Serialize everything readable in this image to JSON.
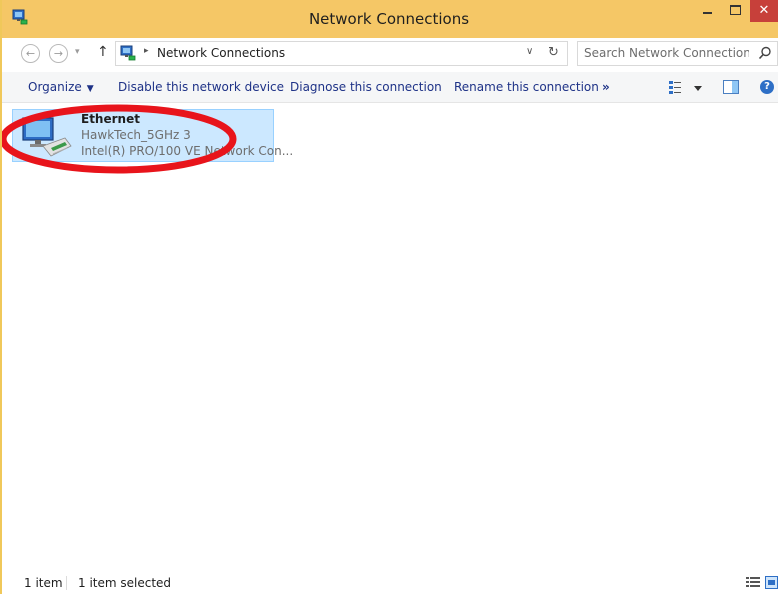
{
  "window": {
    "title": "Network Connections",
    "close_glyph": "✕",
    "title_bar_color": "#f5c766",
    "close_color": "#c7403a"
  },
  "address": {
    "back_glyph": "←",
    "forward_glyph": "→",
    "recent_glyph": "▾",
    "up_glyph": "↑",
    "separator_glyph": "▸",
    "path_text": "Network Connections",
    "dropdown_glyph": "∨",
    "refresh_glyph": "↻",
    "search_placeholder": "Search Network Connections"
  },
  "commands": {
    "organize": "Organize",
    "organize_caret": "▼",
    "disable": "Disable this network device",
    "diagnose": "Diagnose this connection",
    "rename": "Rename this connection",
    "more": "»",
    "help_glyph": "?",
    "link_color": "#1e3287"
  },
  "items": [
    {
      "name": "Ethernet",
      "status": "HawkTech_5GHz  3",
      "device": "Intel(R) PRO/100 VE Network Con...",
      "selected": true
    }
  ],
  "status": {
    "count": "1 item",
    "selected": "1 item selected"
  },
  "icons": {
    "app": "network-connections-icon",
    "search": "search-icon",
    "view_options": "change-view-icon",
    "preview_pane": "preview-pane-icon",
    "help": "help-icon",
    "item": "network-adapter-icon",
    "details_view": "details-view-icon",
    "large_icons_view": "large-icons-view-icon"
  },
  "annotation": {
    "shape": "red-ellipse",
    "color": "#e8141b"
  }
}
